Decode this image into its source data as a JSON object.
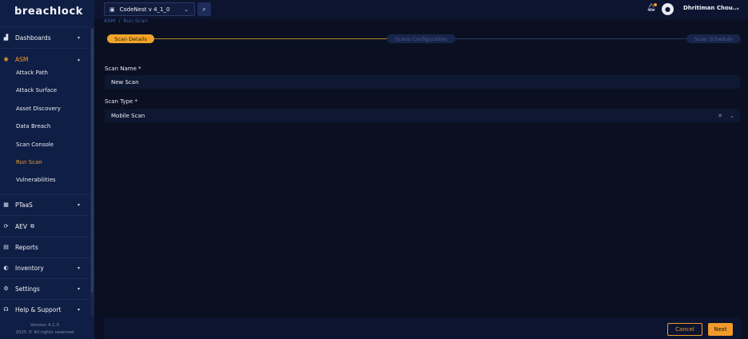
{
  "sidebar": {
    "logo": "breachlock",
    "items": [
      {
        "label": "Dashboards",
        "icon": "chart-icon"
      },
      {
        "label": "ASM",
        "icon": "target-icon"
      },
      {
        "label": "PTaaS",
        "icon": "grid-icon"
      },
      {
        "label": "AEV",
        "icon": "sync-icon"
      },
      {
        "label": "Reports",
        "icon": "document-icon"
      },
      {
        "label": "Inventory",
        "icon": "inventory-icon"
      },
      {
        "label": "Settings",
        "icon": "gear-icon"
      },
      {
        "label": "Help & Support",
        "icon": "headset-icon"
      }
    ],
    "asm_subitems": [
      "Attack Path",
      "Attack Surface",
      "Asset Discovery",
      "Data Breach",
      "Scan Console",
      "Run Scan",
      "Vulnerabilities"
    ],
    "version": "Version 4.1.0",
    "copyright": "2025 © All rights reserved"
  },
  "topbar": {
    "project": "CodeNest v 4_1_0",
    "username": "Dhritiman Chou..."
  },
  "breadcrumb": [
    "ASM",
    "Run Scan"
  ],
  "steps": [
    "Scan Details",
    "Scans Configuration",
    "Scan Schedule"
  ],
  "form": {
    "scan_name_label": "Scan Name *",
    "scan_name_value": "New Scan",
    "scan_type_label": "Scan Type *",
    "scan_type_value": "Mobile Scan"
  },
  "footer": {
    "cancel": "Cancel",
    "next": "Next"
  },
  "colors": {
    "accent": "#f09a2c",
    "sidebar_bg": "#0f1e45",
    "page_bg": "#0a1021"
  }
}
